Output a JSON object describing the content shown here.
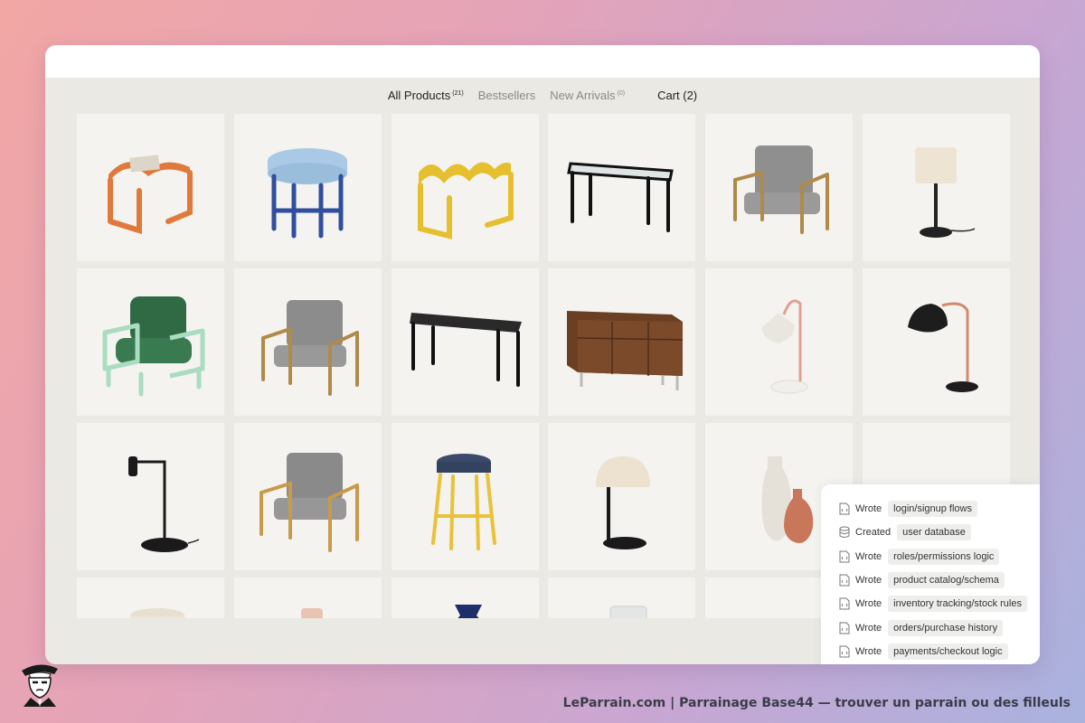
{
  "nav": {
    "all_products_label": "All Products",
    "all_products_count": "(21)",
    "bestsellers_label": "Bestsellers",
    "new_arrivals_label": "New Arrivals",
    "new_arrivals_count": "(0)",
    "cart_label": "Cart (2)"
  },
  "products": [
    "orange-wave-side-table",
    "blue-cushion-stool",
    "yellow-wave-bench",
    "glass-top-console",
    "gray-armchair-brass-frame",
    "cream-shade-table-lamp",
    "green-armchair-mint-frame",
    "gray-lounge-chair",
    "black-writing-desk",
    "walnut-media-console",
    "white-cone-arc-lamp",
    "black-dome-desk-lamp",
    "black-task-lamp",
    "gray-chair-gold-frame",
    "navy-yellow-stool",
    "cream-mushroom-lamp",
    "cream-terracotta-vases",
    "hidden-product"
  ],
  "activity_log": [
    {
      "verb": "Wrote",
      "target": "login/signup flows",
      "icon": "file-code-icon"
    },
    {
      "verb": "Created",
      "target": "user database",
      "icon": "database-icon"
    },
    {
      "verb": "Wrote",
      "target": "roles/permissions logic",
      "icon": "file-code-icon"
    },
    {
      "verb": "Wrote",
      "target": "product catalog/schema",
      "icon": "file-code-icon"
    },
    {
      "verb": "Wrote",
      "target": "inventory tracking/stock rules",
      "icon": "file-code-icon"
    },
    {
      "verb": "Wrote",
      "target": "orders/purchase history",
      "icon": "file-code-icon"
    },
    {
      "verb": "Wrote",
      "target": "payments/checkout logic",
      "icon": "file-code-icon"
    }
  ],
  "footer": {
    "text": "LeParrain.com | Parrainage Base44 — trouver un parrain ou des filleuls"
  }
}
